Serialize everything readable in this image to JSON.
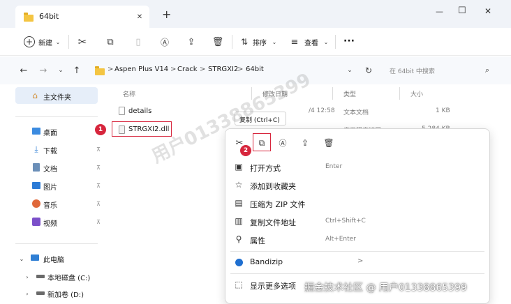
{
  "window": {
    "tab_title": "64bit",
    "new_tab": "+",
    "minimize": "—",
    "maximize": "☐",
    "close": "✕"
  },
  "toolbar": {
    "new_label": "新建",
    "sort_label": "排序",
    "view_label": "查看",
    "more": "···"
  },
  "addressbar": {
    "crumbs": [
      "Aspen Plus V14",
      "Crack",
      "STRGXI2",
      "64bit"
    ],
    "separator": ">",
    "search_placeholder": "在 64bit 中搜索"
  },
  "sidebar": {
    "home": "主文件夹",
    "items": [
      {
        "label": "桌面",
        "icon": "desktop-icon",
        "pinned": true
      },
      {
        "label": "下载",
        "icon": "download-icon",
        "pinned": true
      },
      {
        "label": "文档",
        "icon": "documents-icon",
        "pinned": true
      },
      {
        "label": "图片",
        "icon": "pictures-icon",
        "pinned": true
      },
      {
        "label": "音乐",
        "icon": "music-icon",
        "pinned": true
      },
      {
        "label": "视频",
        "icon": "videos-icon",
        "pinned": true
      }
    ],
    "this_pc": "此电脑",
    "drives": [
      "本地磁盘 (C:)",
      "新加卷 (D:)"
    ]
  },
  "filelist": {
    "columns": [
      "名称",
      "修改日期",
      "类型",
      "大小"
    ],
    "rows": [
      {
        "name": "details",
        "date": "/4 12:58",
        "type": "文本文档",
        "size": "1 KB"
      },
      {
        "name": "STRGXI2.dll",
        "date": "",
        "type": "应用程序扩展",
        "size": "5,284 KB"
      }
    ]
  },
  "context_menu": {
    "tooltip": "复制 (Ctrl+C)",
    "items": [
      {
        "label": "打开方式",
        "shortcut": "Enter",
        "icon": "open-with-icon"
      },
      {
        "label": "添加到收藏夹",
        "shortcut": "",
        "icon": "star-icon"
      },
      {
        "label": "压缩为 ZIP 文件",
        "shortcut": "",
        "icon": "zip-icon"
      },
      {
        "label": "复制文件地址",
        "shortcut": "Ctrl+Shift+C",
        "icon": "copy-path-icon"
      },
      {
        "label": "属性",
        "shortcut": "Alt+Enter",
        "icon": "wrench-icon"
      },
      {
        "label": "Bandizip",
        "shortcut": "",
        "icon": "bandizip-icon"
      },
      {
        "label": "显示更多选项",
        "shortcut": "",
        "icon": "more-options-icon"
      }
    ],
    "submenu_arrow": ">"
  },
  "annotations": {
    "step1": "1",
    "step2": "2"
  },
  "watermarks": {
    "diagonal": "用户01338865399",
    "footer": "掘金技术社区 @ 用户01338865399"
  },
  "colors": {
    "accent": "#0067c0",
    "annotation_red": "#d7263d",
    "folder_yellow": "#f4c542"
  }
}
